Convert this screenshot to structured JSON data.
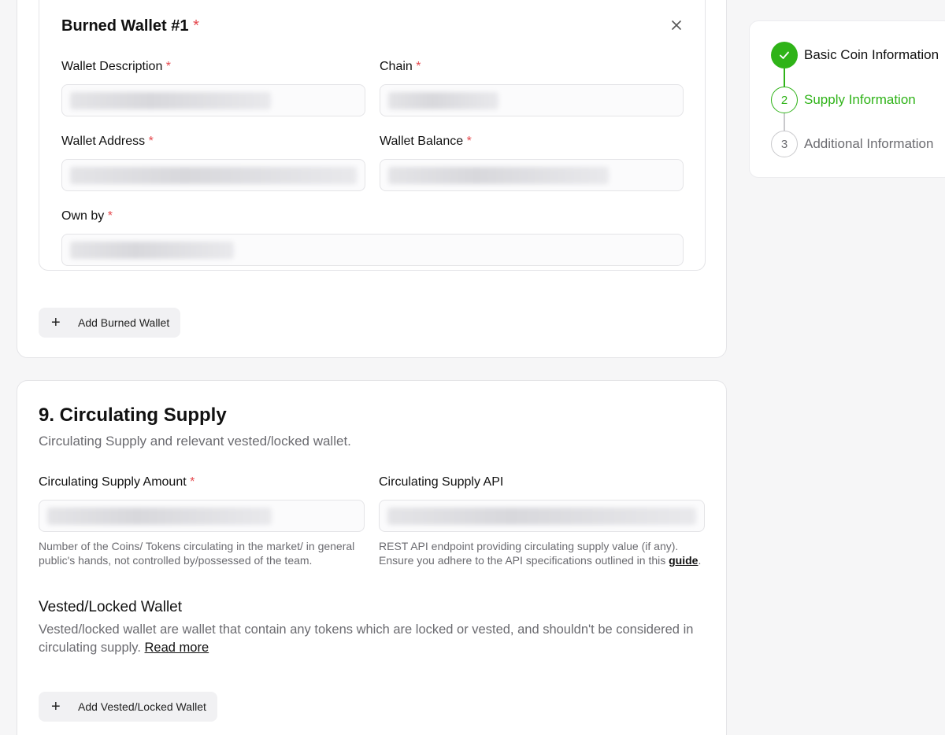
{
  "burned_wallet": {
    "title": "Burned Wallet #1",
    "required_mark": "*",
    "fields": {
      "wallet_description": "Wallet Description",
      "chain": "Chain",
      "wallet_address": "Wallet Address",
      "wallet_balance": "Wallet Balance",
      "own_by": "Own by"
    },
    "add_button": "Add Burned Wallet"
  },
  "circulating_supply": {
    "title": "9. Circulating Supply",
    "subtitle": "Circulating Supply and relevant vested/locked wallet.",
    "amount_label": "Circulating Supply Amount",
    "api_label": "Circulating Supply API",
    "amount_help": "Number of the Coins/ Tokens circulating in the market/ in general public's hands, not controlled by/possessed of the team.",
    "api_help": "REST API endpoint providing circulating supply value (if any). Ensure you adhere to the API specifications outlined in this",
    "api_help_link": "guide",
    "api_help_end": ".",
    "vested": {
      "title": "Vested/Locked Wallet",
      "description": "Vested/locked wallet are wallet that contain any tokens which are locked or vested, and shouldn't be considered in circulating supply.",
      "read_more": "Read more",
      "add_button": "Add Vested/Locked Wallet"
    }
  },
  "stepper": {
    "steps": [
      {
        "number": "1",
        "label": "Basic Coin Information",
        "state": "complete"
      },
      {
        "number": "2",
        "label": "Supply Information",
        "state": "active"
      },
      {
        "number": "3",
        "label": "Additional Information",
        "state": "pending"
      }
    ]
  },
  "colors": {
    "accent_green": "#2fb318",
    "required_red": "#e5484d"
  }
}
